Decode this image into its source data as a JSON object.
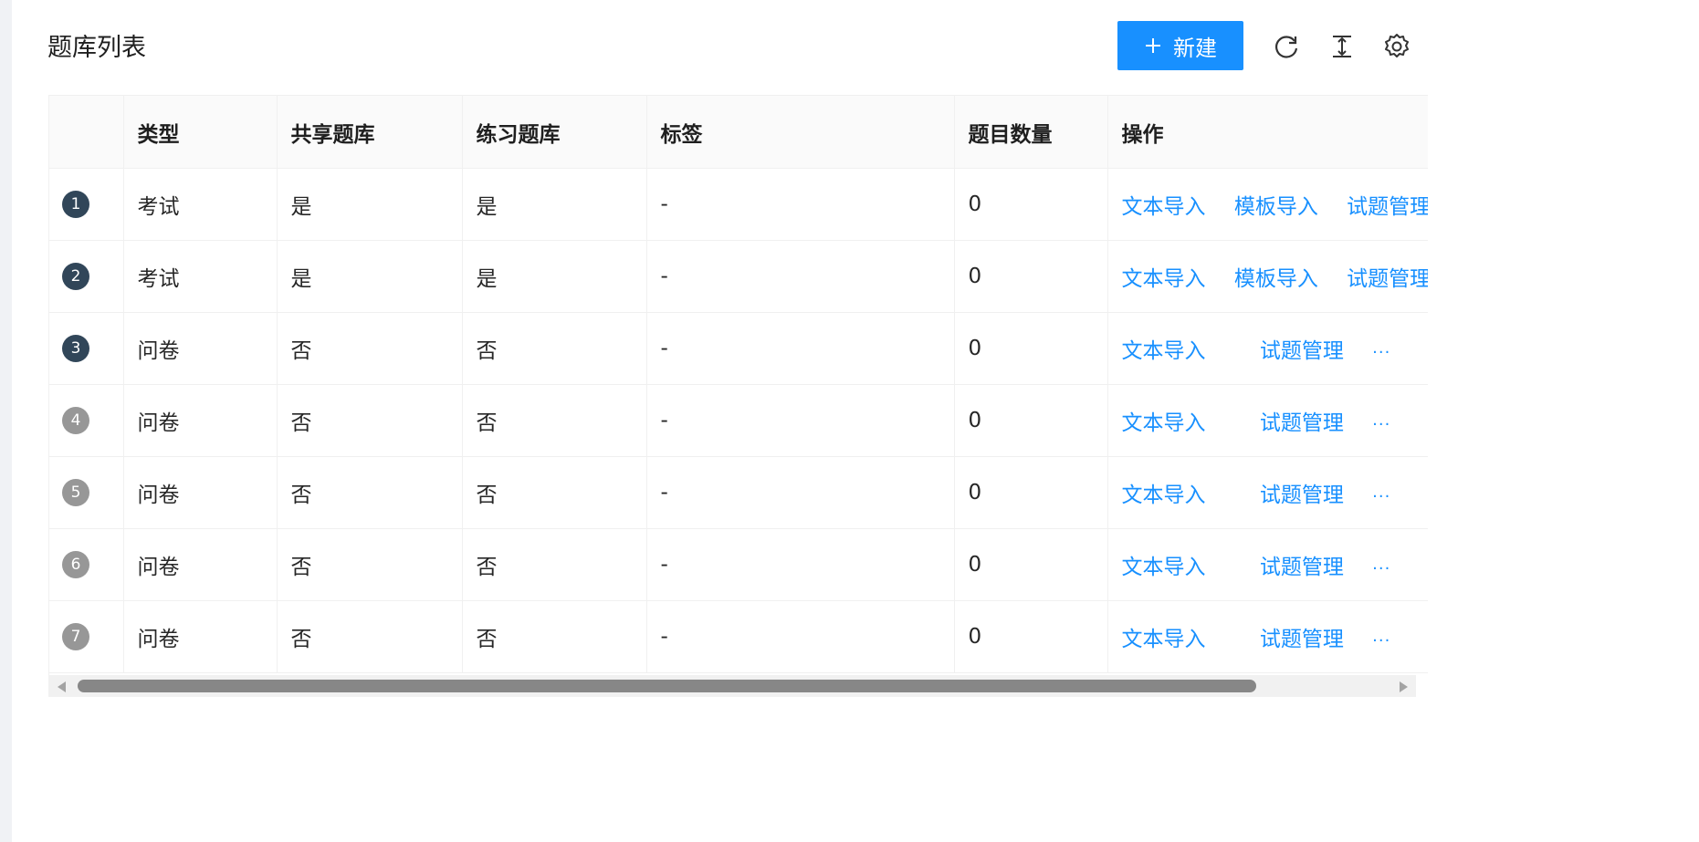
{
  "page": {
    "title": "题库列表"
  },
  "toolbar": {
    "new_label": "新建",
    "icons": [
      "reload-icon",
      "column-height-icon",
      "setting-icon"
    ],
    "primary_color": "#1890ff"
  },
  "table": {
    "columns": [
      "",
      "类型",
      "共享题库",
      "练习题库",
      "标签",
      "题目数量",
      "操作"
    ],
    "rows": [
      {
        "index": "1",
        "type": "考试",
        "shared": "是",
        "practice": "是",
        "tags": "-",
        "count": "0",
        "actions": [
          "文本导入",
          "模板导入",
          "试题管理"
        ]
      },
      {
        "index": "2",
        "type": "考试",
        "shared": "是",
        "practice": "是",
        "tags": "-",
        "count": "0",
        "actions": [
          "文本导入",
          "模板导入",
          "试题管理"
        ]
      },
      {
        "index": "3",
        "type": "问卷",
        "shared": "否",
        "practice": "否",
        "tags": "-",
        "count": "0",
        "actions": [
          "文本导入",
          "试题管理"
        ],
        "more": "···"
      },
      {
        "index": "4",
        "type": "问卷",
        "shared": "否",
        "practice": "否",
        "tags": "-",
        "count": "0",
        "actions": [
          "文本导入",
          "试题管理"
        ],
        "more": "···"
      },
      {
        "index": "5",
        "type": "问卷",
        "shared": "否",
        "practice": "否",
        "tags": "-",
        "count": "0",
        "actions": [
          "文本导入",
          "试题管理"
        ],
        "more": "···"
      },
      {
        "index": "6",
        "type": "问卷",
        "shared": "否",
        "practice": "否",
        "tags": "-",
        "count": "0",
        "actions": [
          "文本导入",
          "试题管理"
        ],
        "more": "···"
      },
      {
        "index": "7",
        "type": "问卷",
        "shared": "否",
        "practice": "否",
        "tags": "-",
        "count": "0",
        "actions": [
          "文本导入",
          "试题管理"
        ],
        "more": "···"
      }
    ]
  }
}
